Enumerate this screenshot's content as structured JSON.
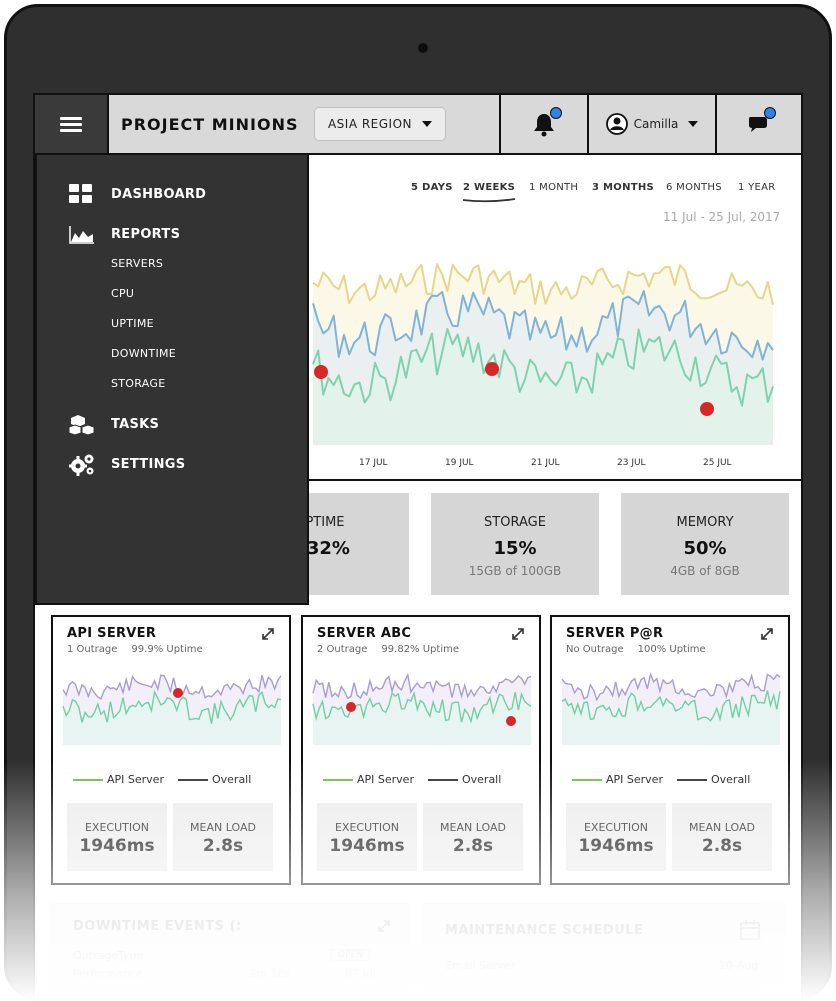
{
  "topbar": {
    "project_title": "PROJECT MINIONS",
    "region_selected": "ASIA REGION",
    "user_name": "Camilla"
  },
  "sidebar": {
    "items": [
      {
        "label": "DASHBOARD"
      },
      {
        "label": "REPORTS"
      },
      {
        "label": "SERVERS"
      },
      {
        "label": "CPU"
      },
      {
        "label": "UPTIME"
      },
      {
        "label": "DOWNTIME"
      },
      {
        "label": "STORAGE"
      },
      {
        "label": "TASKS"
      },
      {
        "label": "SETTINGS"
      }
    ]
  },
  "chart": {
    "ranges": [
      "5 DAYS",
      "2 WEEKS",
      "1 MONTH",
      "3 MONTHS",
      "6 MONTHS",
      "1 YEAR"
    ],
    "active_range": "2 WEEKS",
    "date_range": "11 Jul - 25 Jul, 2017",
    "x_ticks": [
      "17 JUL",
      "19 JUL",
      "21 JUL",
      "23 JUL",
      "25 JUL"
    ],
    "colors": {
      "yellow": "#e5d68a",
      "blue": "#7fb4d8",
      "green": "#7dd3ad",
      "marker": "#d62828"
    }
  },
  "stats": [
    {
      "label": "PTIME",
      "value": ".32%",
      "sub": ""
    },
    {
      "label": "STORAGE",
      "value": "15%",
      "sub": "15GB of 100GB"
    },
    {
      "label": "MEMORY",
      "value": "50%",
      "sub": "4GB of 8GB"
    }
  ],
  "servers": [
    {
      "title": "API SERVER",
      "outrage": "1 Outrage",
      "uptime": "99.9% Uptime",
      "legend_a": "API Server",
      "legend_b": "Overall",
      "exec_label": "EXECUTION",
      "exec_value": "1946ms",
      "load_label": "MEAN LOAD",
      "load_value": "2.8s"
    },
    {
      "title": "SERVER ABC",
      "outrage": "2 Outrage",
      "uptime": "99.82% Uptime",
      "legend_a": "API Server",
      "legend_b": "Overall",
      "exec_label": "EXECUTION",
      "exec_value": "1946ms",
      "load_label": "MEAN LOAD",
      "load_value": "2.8s"
    },
    {
      "title": "SERVER P@R",
      "outrage": "No Outrage",
      "uptime": "100% Uptime",
      "legend_a": "API Server",
      "legend_b": "Overall",
      "exec_label": "EXECUTION",
      "exec_value": "1946ms",
      "load_label": "MEAN LOAD",
      "load_value": "2.8s"
    }
  ],
  "bottom": {
    "downtime_title": "DOWNTIME EVENTS (:",
    "downtime_col1": "OutrageType",
    "downtime_col2": "OPEN",
    "downtime_row1a": "Performance",
    "downtime_row1b": "2m 16s",
    "downtime_row1c": "07 Jul",
    "maintenance_title": "MAINTENANCE SCHEDULE",
    "maintenance_row1a": "Email Server",
    "maintenance_row1b": "10-Aug"
  }
}
